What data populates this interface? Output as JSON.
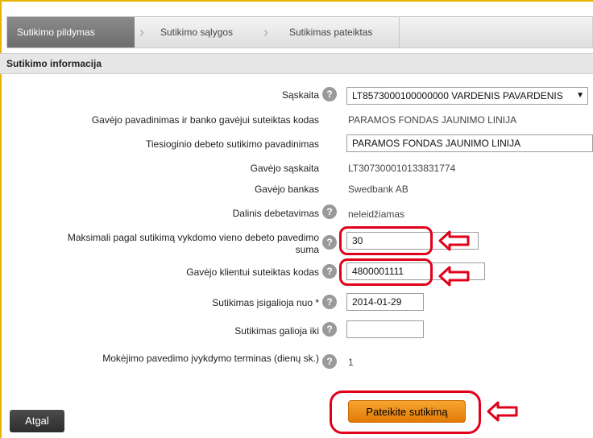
{
  "steps": [
    {
      "label": "Sutikimo pildymas"
    },
    {
      "label": "Sutikimo sąlygos"
    },
    {
      "label": "Sutikimas pateiktas"
    }
  ],
  "section_title": "Sutikimo informacija",
  "fields": {
    "account_label": "Sąskaita",
    "account_value": "LT8573000100000000  VARDENIS PAVARDENIS",
    "payee_name_label": "Gavėjo pavadinimas ir banko gavėjui suteiktas kodas",
    "payee_name_value": "PARAMOS FONDAS JAUNIMO LINIJA",
    "consent_name_label": "Tiesioginio debeto sutikimo pavadinimas",
    "consent_name_value": "PARAMOS FONDAS JAUNIMO LINIJA",
    "payee_account_label": "Gavėjo sąskaita",
    "payee_account_value": "LT307300010133831774",
    "payee_bank_label": "Gavėjo bankas",
    "payee_bank_value": "Swedbank AB",
    "partial_debit_label": "Dalinis debetavimas",
    "partial_debit_value": "neleidžiamas",
    "max_amount_label_1": "Maksimali pagal sutikimą vykdomo vieno debeto pavedimo",
    "max_amount_label_2": "suma",
    "max_amount_value": "30",
    "client_code_label": "Gavėjo klientui suteiktas kodas",
    "client_code_value": "4800001111",
    "valid_from_label": "Sutikimas įsigalioja nuo *",
    "valid_from_value": "2014-01-29",
    "valid_until_label": "Sutikimas galioja iki",
    "valid_until_value": "",
    "term_label": "Mokėjimo pavedimo įvykdymo terminas (dienų sk.)",
    "term_value": "1"
  },
  "help_glyph": "?",
  "buttons": {
    "back": "Atgal",
    "submit": "Pateikite sutikimą"
  },
  "colors": {
    "accent_orange": "#f39a1e",
    "highlight_red": "#e0001a",
    "frame_yellow": "#e8b400"
  }
}
